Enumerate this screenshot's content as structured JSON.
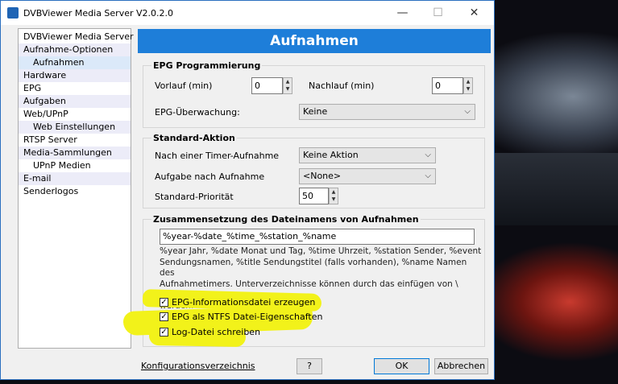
{
  "window": {
    "title": "DVBViewer Media Server V2.0.2.0",
    "minimize": "—",
    "maximize": "☐",
    "close": "✕"
  },
  "nav": {
    "items": [
      {
        "label": "DVBViewer Media Server",
        "level": 0
      },
      {
        "label": "Aufnahme-Optionen",
        "level": 0
      },
      {
        "label": "Aufnahmen",
        "level": 1,
        "selected": true
      },
      {
        "label": "Hardware",
        "level": 0
      },
      {
        "label": "EPG",
        "level": 0
      },
      {
        "label": "Aufgaben",
        "level": 0
      },
      {
        "label": "Web/UPnP",
        "level": 0
      },
      {
        "label": "Web Einstellungen",
        "level": 1
      },
      {
        "label": "RTSP Server",
        "level": 0
      },
      {
        "label": "Media-Sammlungen",
        "level": 0
      },
      {
        "label": "UPnP Medien",
        "level": 1
      },
      {
        "label": "E-mail",
        "level": 0
      },
      {
        "label": "Senderlogos",
        "level": 0
      }
    ]
  },
  "page": {
    "title": "Aufnahmen"
  },
  "epg": {
    "legend": "EPG Programmierung",
    "vorlauf_label": "Vorlauf (min)",
    "vorlauf_value": "0",
    "nachlauf_label": "Nachlauf (min)",
    "nachlauf_value": "0",
    "ueberwachung_label": "EPG-Überwachung:",
    "ueberwachung_value": "Keine"
  },
  "standard": {
    "legend": "Standard-Aktion",
    "timer_label": "Nach einer Timer-Aufnahme",
    "timer_value": "Keine Aktion",
    "aufgabe_label": "Aufgabe nach Aufnahme",
    "aufgabe_value": "<None>",
    "prio_label": "Standard-Priorität",
    "prio_value": "50"
  },
  "filename": {
    "legend": "Zusammensetzung des Dateinamens von Aufnahmen",
    "pattern": "%year-%date_%time_%station_%name",
    "desc_lines": [
      "%year Jahr, %date Monat und Tag, %time Uhrzeit, %station Sender, %event",
      "Sendungsnamen, %title Sendungstitel (falls vorhanden), %name Namen des",
      "Aufnahmetimers. Unterverzeichnisse können durch das einfügen von \\ bestimmt",
      "werden."
    ]
  },
  "options": [
    {
      "label": "EPG-Informationsdatei erzeugen",
      "checked": true
    },
    {
      "label": "EPG als NTFS Datei-Eigenschaften",
      "checked": true
    },
    {
      "label": "Log-Datei schreiben",
      "checked": true
    }
  ],
  "footer": {
    "config_link": "Konfigurationsverzeichnis",
    "help": "?",
    "ok": "OK",
    "cancel": "Abbrechen"
  },
  "colors": {
    "header": "#1e7ed9",
    "highlight": "#f2f21a"
  }
}
